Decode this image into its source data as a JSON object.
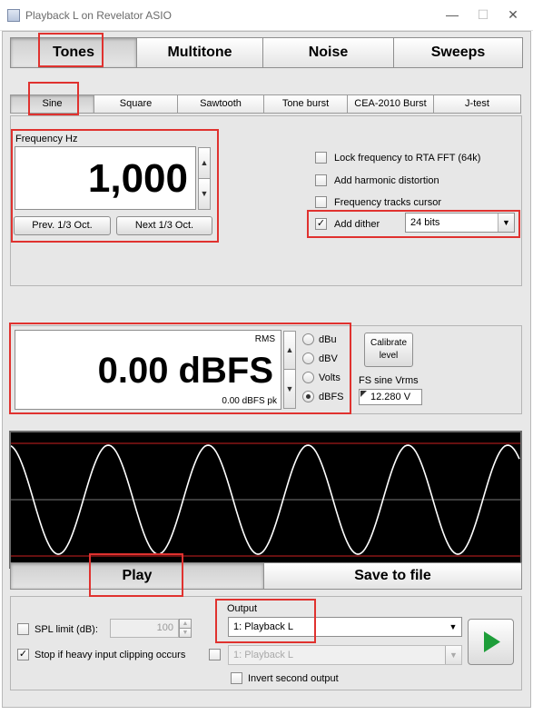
{
  "window": {
    "title": "Playback L on Revelator ASIO",
    "minimize": "—",
    "maximize": "☐",
    "close": "✕"
  },
  "main_tabs": [
    {
      "label": "Tones",
      "selected": true
    },
    {
      "label": "Multitone",
      "selected": false
    },
    {
      "label": "Noise",
      "selected": false
    },
    {
      "label": "Sweeps",
      "selected": false
    }
  ],
  "wave_tabs": [
    {
      "label": "Sine",
      "selected": true
    },
    {
      "label": "Square",
      "selected": false
    },
    {
      "label": "Sawtooth",
      "selected": false
    },
    {
      "label": "Tone burst",
      "selected": false
    },
    {
      "label": "CEA-2010 Burst",
      "selected": false
    },
    {
      "label": "J-test",
      "selected": false
    }
  ],
  "frequency": {
    "label": "Frequency Hz",
    "value": "1,000",
    "prev_button": "Prev. 1/3 Oct.",
    "next_button": "Next 1/3 Oct."
  },
  "options": {
    "lock_rta": {
      "label": "Lock frequency to RTA FFT (64k)",
      "checked": false
    },
    "harmonic": {
      "label": "Add harmonic distortion",
      "checked": false
    },
    "tracks_cursor": {
      "label": "Frequency tracks cursor",
      "checked": false
    },
    "dither": {
      "label": "Add dither",
      "checked": true,
      "bits": "24 bits"
    }
  },
  "level": {
    "mode": "RMS",
    "value": "0.00 dBFS",
    "peak": "0.00 dBFS pk",
    "units": [
      {
        "label": "dBu",
        "selected": false
      },
      {
        "label": "dBV",
        "selected": false
      },
      {
        "label": "Volts",
        "selected": false
      },
      {
        "label": "dBFS",
        "selected": true
      }
    ],
    "calibrate_label": "Calibrate level",
    "fs_label": "FS sine Vrms",
    "fs_value": "12.280 V"
  },
  "actions": {
    "play": "Play",
    "save": "Save to file"
  },
  "bottom": {
    "spl_label": "SPL limit (dB):",
    "spl_value": "100",
    "spl_checked": false,
    "stop_label": "Stop if heavy input clipping occurs",
    "stop_checked": true,
    "output_label": "Output",
    "output_value": "1: Playback L",
    "second_output_value": "1: Playback L",
    "second_output_checked": false,
    "invert_label": "Invert second output",
    "invert_checked": false
  },
  "colors": {
    "play_icon": "#1e9e3a",
    "highlight": "#e0322f",
    "scope_background": "#000000",
    "scope_wave": "#ffffff",
    "scope_limit": "#cc1f1f"
  },
  "icons": {
    "play": "play-icon",
    "app": "app-icon"
  }
}
